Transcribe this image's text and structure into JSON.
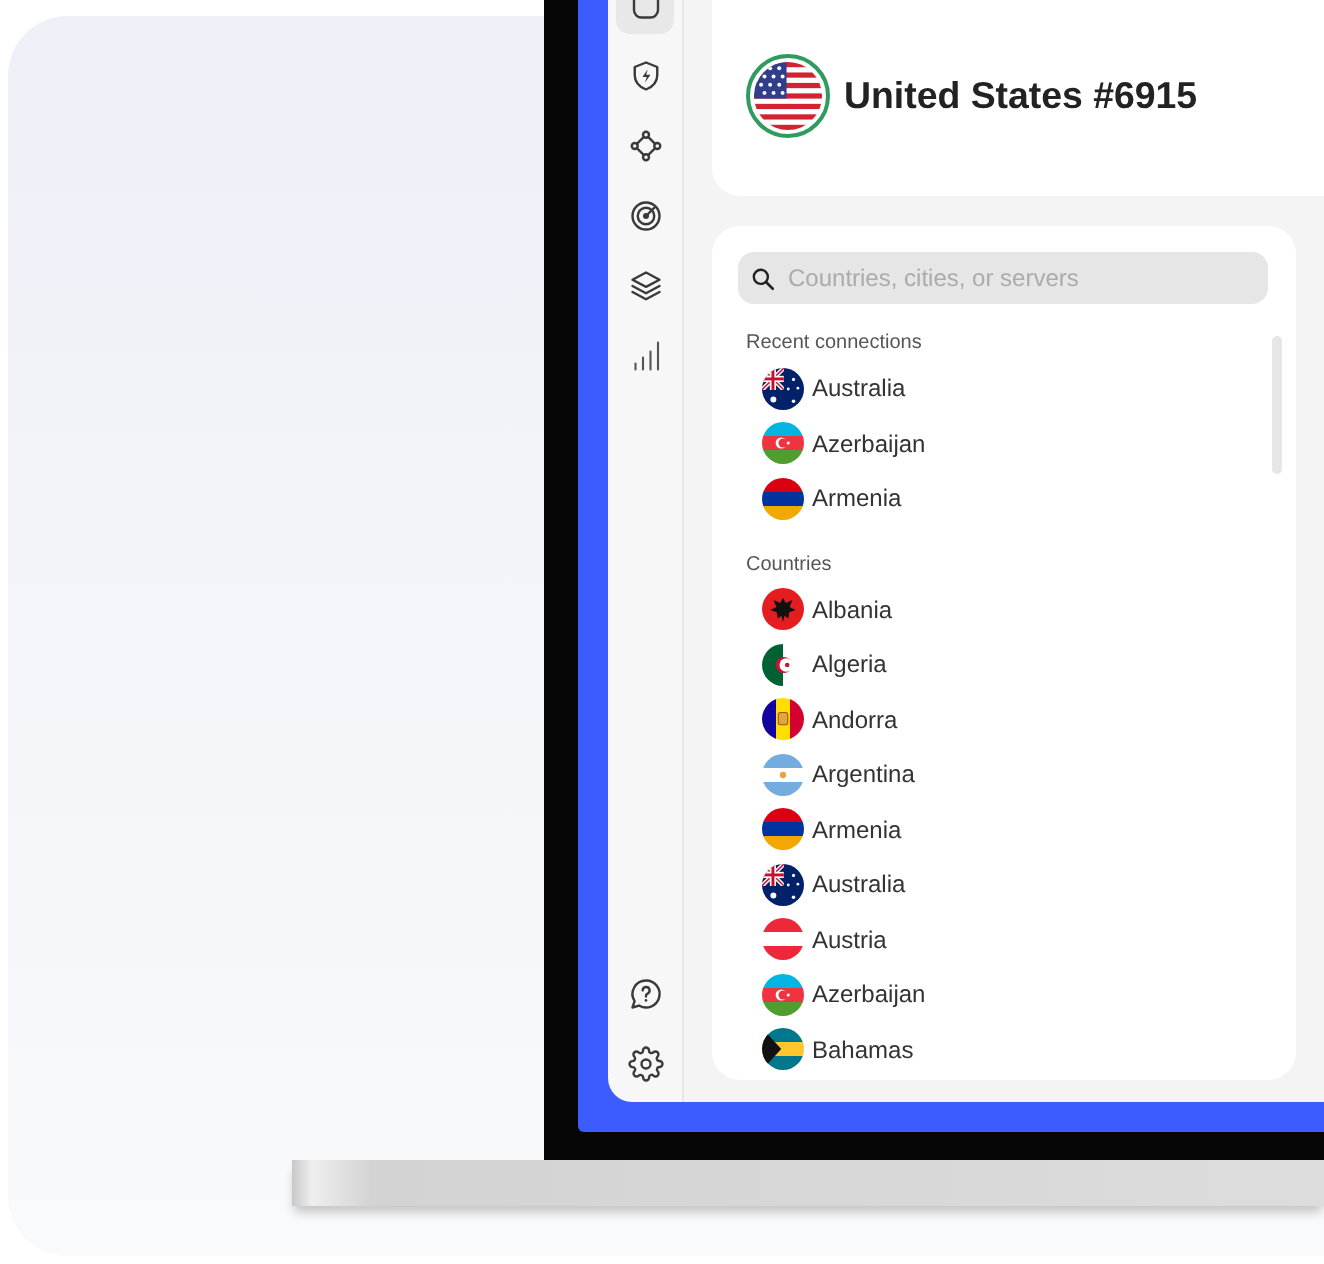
{
  "sidebar": {
    "items": [
      {
        "kind": "square",
        "selected": true
      },
      {
        "kind": "shield",
        "selected": false
      },
      {
        "kind": "network",
        "selected": false
      },
      {
        "kind": "target",
        "selected": false
      },
      {
        "kind": "layers",
        "selected": false
      },
      {
        "kind": "stats",
        "selected": false
      }
    ],
    "footer_items": [
      {
        "kind": "help"
      },
      {
        "kind": "settings"
      }
    ]
  },
  "header": {
    "kind": "us",
    "connected": true,
    "title": "United States #6915"
  },
  "search": {
    "placeholder": "Countries, cities, or servers"
  },
  "sections": [
    {
      "title": "Recent connections",
      "items": [
        {
          "kind": "au",
          "name": "Australia"
        },
        {
          "kind": "az",
          "name": "Azerbaijan"
        },
        {
          "kind": "am",
          "name": "Armenia"
        }
      ]
    },
    {
      "title": "Countries",
      "items": [
        {
          "kind": "al",
          "name": "Albania"
        },
        {
          "kind": "dz",
          "name": "Algeria"
        },
        {
          "kind": "ad",
          "name": "Andorra"
        },
        {
          "kind": "ar",
          "name": "Argentina"
        },
        {
          "kind": "am",
          "name": "Armenia"
        },
        {
          "kind": "au",
          "name": "Australia"
        },
        {
          "kind": "at",
          "name": "Austria"
        },
        {
          "kind": "az",
          "name": "Azerbaijan"
        },
        {
          "kind": "bs",
          "name": "Bahamas"
        }
      ]
    }
  ]
}
